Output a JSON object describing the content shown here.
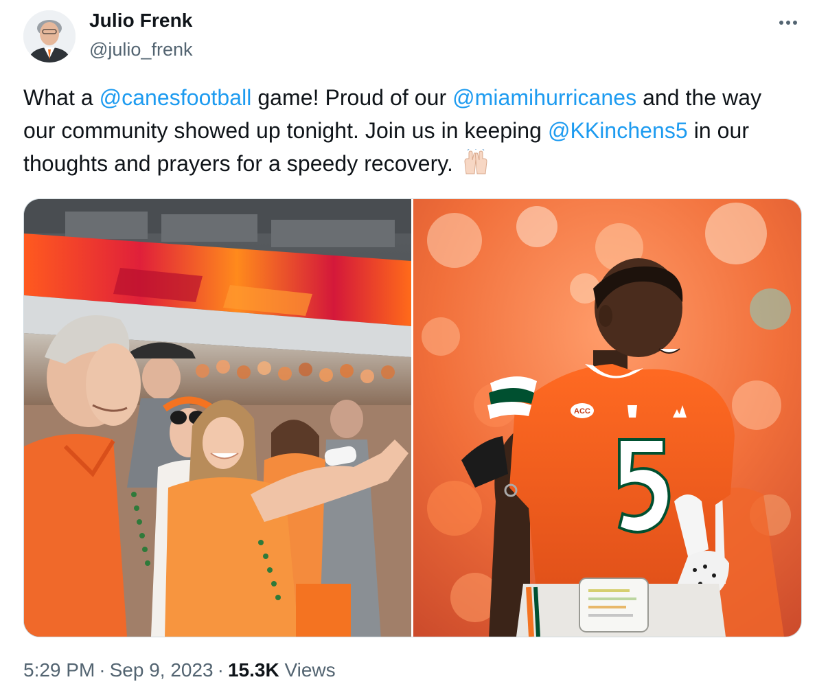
{
  "author": {
    "display_name": "Julio Frenk",
    "handle": "@julio_frenk"
  },
  "tweet": {
    "segments": [
      {
        "type": "text",
        "value": "What a "
      },
      {
        "type": "mention",
        "value": "@canesfootball"
      },
      {
        "type": "text",
        "value": " game! Proud of our "
      },
      {
        "type": "mention",
        "value": "@miamihurricanes"
      },
      {
        "type": "text",
        "value": " and the way our community showed up tonight. Join us in keeping "
      },
      {
        "type": "mention",
        "value": "@KKinchens5"
      },
      {
        "type": "text",
        "value": " in our thoughts and prayers for a speedy recovery."
      }
    ],
    "emoji": "raising-hands",
    "time": "5:29 PM",
    "date": "Sep 9, 2023",
    "views_count": "15.3K",
    "views_label": "Views",
    "separator": "·"
  },
  "media": {
    "jersey_number": "5",
    "patch_text": "ACC"
  },
  "colors": {
    "link": "#1d9bf0",
    "secondary_text": "#536471",
    "primary_text": "#0f1419",
    "border": "#cfd9de",
    "miami_orange": "#f47321",
    "miami_green": "#005030"
  }
}
